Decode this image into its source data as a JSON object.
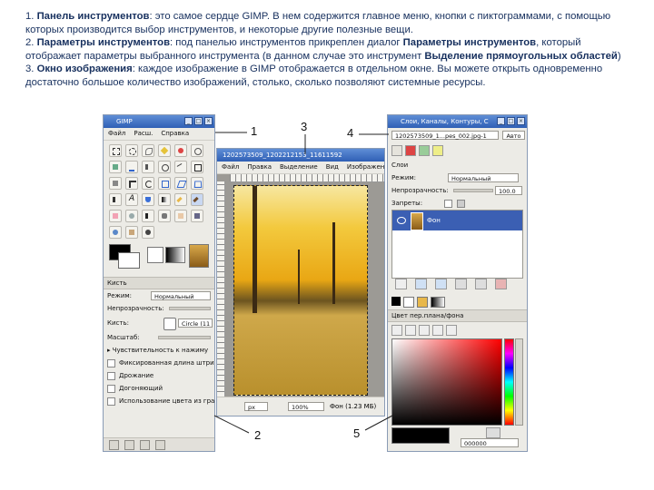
{
  "text": {
    "p1_num": "1.",
    "p1_bold": "Панель инструментов",
    "p1_rest": ": это самое сердце GIMP. В нем содержится главное меню, кнопки с пиктограммами, с помощью которых производится выбор инструментов, и некоторые другие полезные вещи.",
    "p2_num": "2.",
    "p2_bold": "Параметры инструментов",
    "p2_mid": ": под панелью инструментов прикреплен диалог ",
    "p2_bold2": "Параметры инструментов",
    "p2_mid2": ", который отображает параметры выбранного инструмента (в данном случае это инструмент ",
    "p2_bold3": "Выделение прямоугольных областей",
    "p2_end": ")",
    "p3_num": "3.",
    "p3_bold": "Окно изображения",
    "p3_rest": ": каждое изображение в GIMP отображается в отдельном окне. Вы можете открыть одновременно достаточно большое количество изображений, столько, сколько позволяют системные ресурсы."
  },
  "toolbox": {
    "title": "GIMP",
    "menu": [
      "Файл",
      "Расш.",
      "Справка"
    ],
    "options_header": "Кисть",
    "mode_label": "Режим:",
    "mode_value": "Нормальный",
    "opacity_label": "Непрозрачность:",
    "brush_label": "Кисть:",
    "brush_value": "Circle (11",
    "scale_label": "Масштаб:",
    "opt1": "Чувствительность к нажиму",
    "opt2": "Фиксированная длина штрих",
    "opt3": "Дрожание",
    "opt4": "Догоняющий",
    "opt5": "Использование цвета из гра"
  },
  "image_window": {
    "title": "1202573509_1202212153_11611592",
    "menu": [
      "Файл",
      "Правка",
      "Выделение",
      "Вид",
      "Изображение"
    ],
    "unit": "px",
    "zoom": "100%",
    "status": "Фон (1.23 МБ)"
  },
  "layers_window": {
    "title": "Слои, Каналы, Контуры, С",
    "image_combo": "1202573509_1...pes_002.jpg-1",
    "auto_button": "Авто",
    "layers_label": "Слои",
    "mode_label": "Режим:",
    "mode_value": "Нормальный",
    "opacity_label": "Непрозрачность:",
    "opacity_value": "100.0",
    "lock_label": "Запреты:",
    "layer_name": "Фон",
    "fgbg_label": "Цвет пер.плана/фона",
    "hex_value": "000000"
  },
  "callouts": [
    "1",
    "2",
    "3",
    "4",
    "5"
  ],
  "colors": {
    "text": "#17305e",
    "titlebar": "#2f5fb5",
    "selected_layer": "#3b5fb3"
  }
}
